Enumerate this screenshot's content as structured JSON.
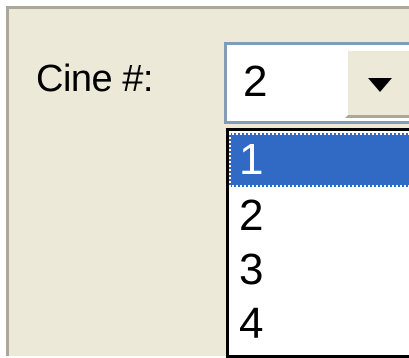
{
  "cine_selector": {
    "label": "Cine #:",
    "current_value": "2",
    "dropdown_icon": "chevron-down-icon",
    "options": [
      {
        "label": "1",
        "highlighted": true
      },
      {
        "label": "2",
        "highlighted": false
      },
      {
        "label": "3",
        "highlighted": false
      },
      {
        "label": "4",
        "highlighted": false
      }
    ]
  },
  "colors": {
    "dialog_background": "#ece9d8",
    "combo_border": "#7f9db9",
    "highlight": "#316ac5",
    "highlight_text": "#ffffff"
  }
}
